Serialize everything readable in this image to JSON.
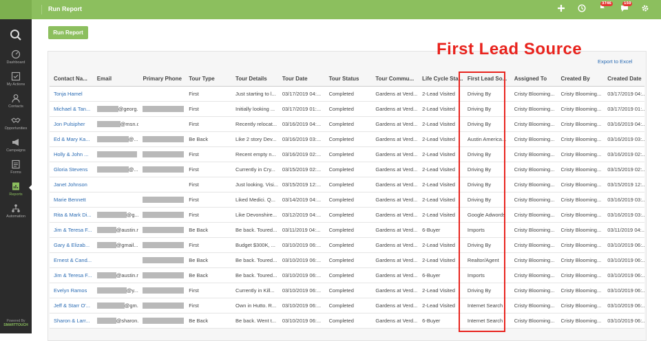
{
  "topbar": {
    "title": "Run Report",
    "badge_1": "3746",
    "badge_2": "150"
  },
  "sidebar": {
    "items": [
      {
        "label": "Dashboard",
        "icon": "dashboard-icon"
      },
      {
        "label": "My Actions",
        "icon": "checkbox-icon"
      },
      {
        "label": "Contacts",
        "icon": "contacts-icon"
      },
      {
        "label": "Opportunities",
        "icon": "handshake-icon"
      },
      {
        "label": "Campaigns",
        "icon": "megaphone-icon"
      },
      {
        "label": "Forms",
        "icon": "form-icon"
      },
      {
        "label": "Reports",
        "icon": "report-icon"
      },
      {
        "label": "Automation",
        "icon": "automation-icon"
      }
    ],
    "powered_by": "Powered By",
    "brand": "SMARTTOUCH"
  },
  "run_report_button": "Run Report",
  "export_link": "Export to Excel",
  "annotation": "First Lead Source",
  "colors": {
    "accent": "#8cbf5e",
    "link": "#2a6bb3",
    "annotation": "#e8221c",
    "sidebar": "#2b2b2b"
  },
  "table": {
    "columns": [
      "Contact Na...",
      "Email",
      "Primary Phone",
      "Tour Type",
      "Tour Details",
      "Tour Date",
      "Tour Status",
      "Tour Commu...",
      "Life Cycle Sta...",
      "First Lead So...",
      "Assigned To",
      "Created By",
      "Created Date"
    ],
    "rows": [
      {
        "name": "Tonja Hamel",
        "email": "",
        "phone": "",
        "type": "First",
        "details": "Just starting to l...",
        "date": "03/17/2019 04:...",
        "status": "Completed",
        "community": "Gardens at Verd...",
        "lifecycle": "2-Lead Visited",
        "source": "Driving By",
        "assigned": "Cristy Blooming...",
        "created_by": "Cristy Blooming...",
        "created": "03/17/2019 04:..."
      },
      {
        "name": "Michael & Tan...",
        "email": "@georg...",
        "phone": "",
        "type": "First",
        "details": "Initially looking ...",
        "date": "03/17/2019 01:...",
        "status": "Completed",
        "community": "Gardens at Verd...",
        "lifecycle": "2-Lead Visited",
        "source": "Driving By",
        "assigned": "Cristy Blooming...",
        "created_by": "Cristy Blooming...",
        "created": "03/17/2019 01:..."
      },
      {
        "name": "Jon Pulsipher",
        "email": "@msn.com",
        "phone": "",
        "type": "First",
        "details": "Recently relocat...",
        "date": "03/16/2019 04:...",
        "status": "Completed",
        "community": "Gardens at Verd...",
        "lifecycle": "2-Lead Visited",
        "source": "Driving By",
        "assigned": "Cristy Blooming...",
        "created_by": "Cristy Blooming...",
        "created": "03/16/2019 04:..."
      },
      {
        "name": "Ed & Mary Ka...",
        "email": "@...",
        "phone": "",
        "type": "Be Back",
        "details": "Like 2 story Dev...",
        "date": "03/16/2019 03:...",
        "status": "Completed",
        "community": "Gardens at Verd...",
        "lifecycle": "2-Lead Visited",
        "source": "Austin America...",
        "assigned": "Cristy Blooming...",
        "created_by": "Cristy Blooming...",
        "created": "03/16/2019 03:..."
      },
      {
        "name": "Holly & John ...",
        "email": "",
        "phone": "",
        "type": "First",
        "details": "Recent empty n...",
        "date": "03/16/2019 02:...",
        "status": "Completed",
        "community": "Gardens at Verd...",
        "lifecycle": "2-Lead Visited",
        "source": "Driving By",
        "assigned": "Cristy Blooming...",
        "created_by": "Cristy Blooming...",
        "created": "03/16/2019 02:..."
      },
      {
        "name": "Gloria Stevens",
        "email": "@...",
        "phone": "",
        "type": "First",
        "details": "Currently in Cry...",
        "date": "03/15/2019 02:...",
        "status": "Completed",
        "community": "Gardens at Verd...",
        "lifecycle": "2-Lead Visited",
        "source": "Driving By",
        "assigned": "Cristy Blooming...",
        "created_by": "Cristy Blooming...",
        "created": "03/15/2019 02:..."
      },
      {
        "name": "Janet Johnson",
        "email": "",
        "phone": "",
        "type": "First",
        "details": "Just looking. Visi...",
        "date": "03/15/2019 12:...",
        "status": "Completed",
        "community": "Gardens at Verd...",
        "lifecycle": "2-Lead Visited",
        "source": "Driving By",
        "assigned": "Cristy Blooming...",
        "created_by": "Cristy Blooming...",
        "created": "03/15/2019 12:..."
      },
      {
        "name": "Marie Bennett",
        "email": "",
        "phone": "",
        "type": "First",
        "details": "Liked Medici. Q...",
        "date": "03/14/2019 04:...",
        "status": "Completed",
        "community": "Gardens at Verd...",
        "lifecycle": "2-Lead Visited",
        "source": "Driving By",
        "assigned": "Cristy Blooming...",
        "created_by": "Cristy Blooming...",
        "created": "03/16/2019 03:..."
      },
      {
        "name": "Rita & Mark Di...",
        "email": "@g...",
        "phone": "",
        "type": "First",
        "details": "Like Devonshire...",
        "date": "03/12/2019 04:...",
        "status": "Completed",
        "community": "Gardens at Verd...",
        "lifecycle": "2-Lead Visited",
        "source": "Google Adwords",
        "assigned": "Cristy Blooming...",
        "created_by": "Cristy Blooming...",
        "created": "03/16/2019 03:..."
      },
      {
        "name": "Jim & Teresa F...",
        "email": "@austin.rr....",
        "phone": "",
        "type": "Be Back",
        "details": "Be back. Toured...",
        "date": "03/11/2019 04:...",
        "status": "Completed",
        "community": "Gardens at Verd...",
        "lifecycle": "6-Buyer",
        "source": "Imports",
        "assigned": "Cristy Blooming...",
        "created_by": "Cristy Blooming...",
        "created": "03/11/2019 04:..."
      },
      {
        "name": "Gary & Elizab...",
        "email": "@gmail....",
        "phone": "",
        "type": "First",
        "details": "Budget $300K, ...",
        "date": "03/10/2019 06:...",
        "status": "Completed",
        "community": "Gardens at Verd...",
        "lifecycle": "2-Lead Visited",
        "source": "Driving By",
        "assigned": "Cristy Blooming...",
        "created_by": "Cristy Blooming...",
        "created": "03/10/2019 06:..."
      },
      {
        "name": "Ernest & Cand...",
        "email": "",
        "phone": "",
        "type": "Be Back",
        "details": "Be back. Toured...",
        "date": "03/10/2019 06:...",
        "status": "Completed",
        "community": "Gardens at Verd...",
        "lifecycle": "2-Lead Visited",
        "source": "Realtor/Agent",
        "assigned": "Cristy Blooming...",
        "created_by": "Cristy Blooming...",
        "created": "03/10/2019 06:..."
      },
      {
        "name": "Jim & Teresa F...",
        "email": "@austin.rr....",
        "phone": "",
        "type": "Be Back",
        "details": "Be back. Toured...",
        "date": "03/10/2019 06:...",
        "status": "Completed",
        "community": "Gardens at Verd...",
        "lifecycle": "6-Buyer",
        "source": "Imports",
        "assigned": "Cristy Blooming...",
        "created_by": "Cristy Blooming...",
        "created": "03/10/2019 06:..."
      },
      {
        "name": "Evelyn Ramos",
        "email": "@y...",
        "phone": "",
        "type": "First",
        "details": "Currently in Kill...",
        "date": "03/10/2019 06:...",
        "status": "Completed",
        "community": "Gardens at Verd...",
        "lifecycle": "2-Lead Visited",
        "source": "Driving By",
        "assigned": "Cristy Blooming...",
        "created_by": "Cristy Blooming...",
        "created": "03/10/2019 06:..."
      },
      {
        "name": "Jeff & Starr O'...",
        "email": "@gm...",
        "phone": "",
        "type": "First",
        "details": "Own in Hutto. R...",
        "date": "03/10/2019 06:...",
        "status": "Completed",
        "community": "Gardens at Verd...",
        "lifecycle": "2-Lead Visited",
        "source": "Internet Search",
        "assigned": "Cristy Blooming...",
        "created_by": "Cristy Blooming...",
        "created": "03/10/2019 06:..."
      },
      {
        "name": "Sharon & Larr...",
        "email": "@sharon...",
        "phone": "",
        "type": "Be Back",
        "details": "Be back. Went t...",
        "date": "03/10/2019 06:...",
        "status": "Completed",
        "community": "Gardens at Verd...",
        "lifecycle": "6-Buyer",
        "source": "Internet Search",
        "assigned": "Cristy Blooming...",
        "created_by": "Cristy Blooming...",
        "created": "03/10/2019 06:..."
      }
    ]
  }
}
